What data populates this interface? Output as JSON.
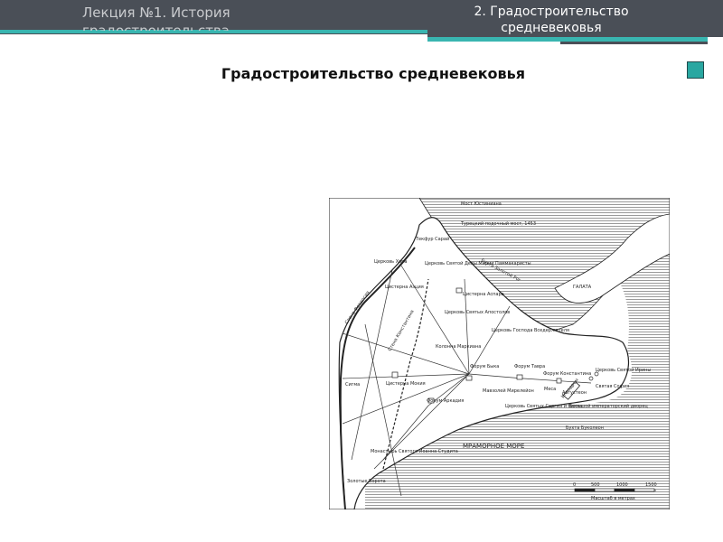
{
  "header": {
    "lecture_title": "Лекция №1. История\nградостроительства",
    "section_title": "2. Градостроительство средневековья"
  },
  "slide": {
    "title": "Градостроительство средневековья"
  },
  "map": {
    "labels": {
      "bridge_justinian": "Мост Юстиниана",
      "pontoon_bridge": "Турецкий подочный мост, 1453",
      "tekfur_palace": "Текфур Сарай",
      "chora_church": "Церковь Хора",
      "church_mary": "Церковь Святой Девы Марии Паммакаристы",
      "golden_horn": "Бухта Золотой Рог",
      "galata": "ГАЛАТА",
      "cistern_aetius": "Цистерна Аэция",
      "cistern_aspar": "Цистерна Аспара",
      "wall_theodosius": "Стена Феодосия",
      "wall_constantine": "Стена Константина",
      "holy_apostles": "Церковь Святых Апостолов",
      "pantocrator": "Церковь Господа Вседержителя",
      "marcian_column": "Колонна Маркиана",
      "forum_bovis": "Форум Быка",
      "forum_tauri": "Форум Тавра",
      "forum_constantine": "Форум Константина",
      "hagia_irene": "Церковь Святой Ирины",
      "hagia_sophia": "Святая София",
      "augusteon": "Августеон",
      "sigma": "Сигма",
      "cistern_mokios": "Цистерна Мокия",
      "mese": "Меса",
      "myrelaion": "Мавзолей Мирелейон",
      "forum_arcadius": "Форум Аркадия",
      "sergius_bacchus": "Церковь Святых Сергия и Вакха",
      "great_palace": "Большой императорский дворец",
      "bukoleon": "Бухта Буколеон",
      "hippodrome": "Ипподром",
      "marmara": "МРАМОРНОЕ МОРЕ",
      "studios": "Монастырь Святого Иоанна Студита",
      "golden_gate": "Золотые Ворота",
      "scale_label": "Масштаб в метрах"
    },
    "scale_ticks": [
      "0",
      "500",
      "1000",
      "1500"
    ]
  }
}
